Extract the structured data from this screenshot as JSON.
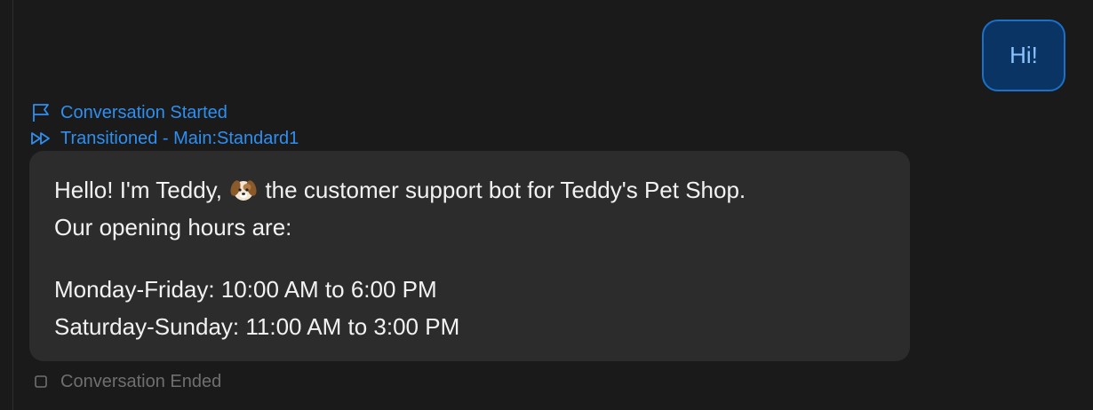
{
  "user_message": {
    "text": "Hi!"
  },
  "events": {
    "started": {
      "label": "Conversation Started",
      "icon": "flag-icon"
    },
    "transition": {
      "label": "Transitioned - Main:Standard1",
      "icon": "fast-forward-icon"
    },
    "ended": {
      "label": "Conversation Ended",
      "icon": "square-icon"
    }
  },
  "bot_message": {
    "line1_before": "Hello! I'm Teddy,",
    "emoji": "dog-face-emoji",
    "line1_after": "the customer support bot for Teddy's Pet Shop.",
    "line2": "Our opening hours are:",
    "hours": [
      "Monday-Friday: 10:00 AM to 6:00 PM",
      "Saturday-Sunday: 11:00 AM to 3:00 PM"
    ]
  },
  "colors": {
    "background": "#1a1a1a",
    "accent": "#2f8ff0",
    "user_bubble_bg": "#0a3463",
    "user_bubble_border": "#1b70c9",
    "bot_bubble_bg": "#2c2c2c",
    "muted": "#6f6f6f"
  }
}
